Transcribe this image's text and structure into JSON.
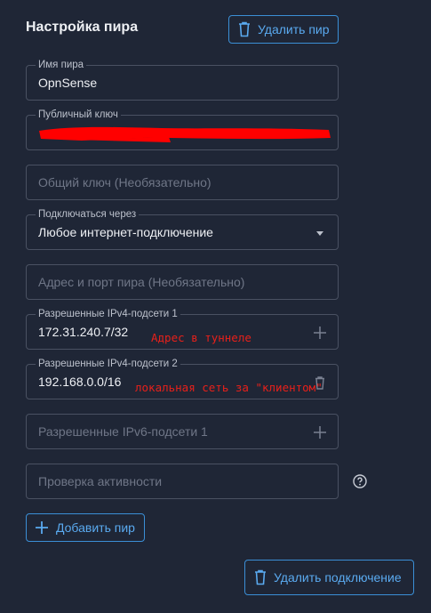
{
  "header": {
    "title": "Настройка пира",
    "delete_peer_label": "Удалить пир"
  },
  "fields": {
    "peer_name": {
      "label": "Имя пира",
      "value": "OpnSense"
    },
    "public_key": {
      "label": "Публичный ключ",
      "value": ""
    },
    "preshared_key": {
      "placeholder": "Общий ключ (Необязательно)"
    },
    "connect_via": {
      "label": "Подключаться через",
      "value": "Любое интернет-подключение"
    },
    "endpoint": {
      "placeholder": "Адрес и порт пира (Необязательно)"
    },
    "ipv4_1": {
      "label": "Разрешенные IPv4-подсети 1",
      "value": "172.31.240.7/32"
    },
    "ipv4_2": {
      "label": "Разрешенные IPv4-подсети 2",
      "value": "192.168.0.0/16"
    },
    "ipv6_1": {
      "placeholder": "Разрешенные IPv6-подсети 1"
    },
    "keepalive": {
      "placeholder": "Проверка активности"
    }
  },
  "annotations": {
    "tunnel_address": "Адрес в туннеле",
    "client_lan": "локальная сеть за \"клиентом\""
  },
  "actions": {
    "add_peer_label": "Добавить пир",
    "delete_connection_label": "Удалить подключение"
  },
  "icons": {
    "trash": "trash-icon",
    "plus": "plus-icon",
    "caret": "caret-down-icon",
    "help": "help-circle-icon"
  },
  "colors": {
    "background": "#1f2636",
    "accent": "#3b8fd6",
    "field_border": "#4a5162",
    "annotation_red": "#e8201a"
  }
}
